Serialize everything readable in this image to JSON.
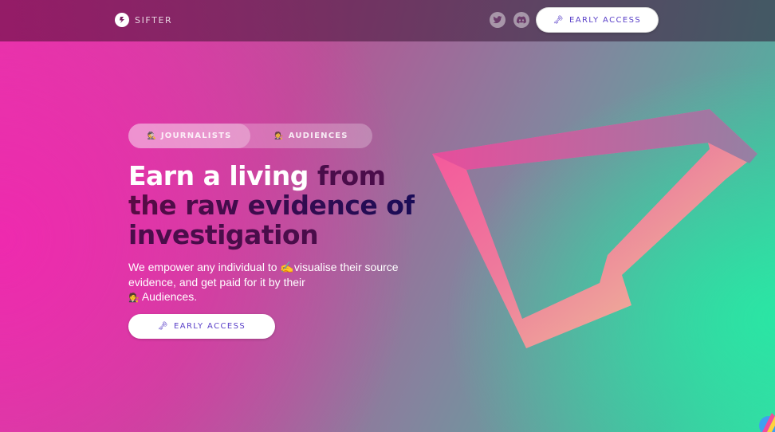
{
  "header": {
    "logo_text": "SIFTER",
    "social_links": [
      {
        "name": "twitter",
        "icon": "twitter-icon"
      },
      {
        "name": "discord",
        "icon": "discord-icon"
      }
    ],
    "cta_label": "EARLY ACCESS",
    "cta_icon": "key-icon"
  },
  "hero": {
    "tabs": [
      {
        "label": "JOURNALISTS",
        "emoji": "🕵",
        "active": true
      },
      {
        "label": "AUDIENCES",
        "emoji": "🧑‍⚖️",
        "active": false
      }
    ],
    "headline": {
      "part1": "Earn a living ",
      "part2": "from",
      "line2": "the raw evidence of",
      "line3": "investigation"
    },
    "subtext": {
      "part1": "We empower any individual to ",
      "emoji1": "✍️",
      "part2": "visualise their source evidence, and get paid for it by their",
      "emoji2": "🧑‍⚖️",
      "part3": " Audiences."
    },
    "cta_label": "EARLY ACCESS",
    "cta_icon": "key-icon"
  },
  "colors": {
    "accent": "#5a40c8",
    "pink": "#ee2aae",
    "green": "#2ae6a4",
    "headline_dark": "#4a0d4a"
  }
}
